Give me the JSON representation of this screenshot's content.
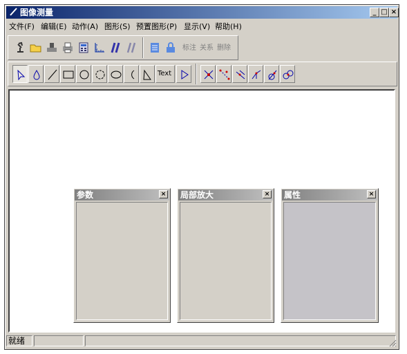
{
  "window": {
    "title": "图像测量",
    "minimize": "_",
    "maximize": "□",
    "close": "×"
  },
  "menu": [
    {
      "label": "文件(F)"
    },
    {
      "label": "编辑(E)"
    },
    {
      "label": "动作(A)"
    },
    {
      "label": "图形(S)"
    },
    {
      "label": "预置图形(P)"
    },
    {
      "label": "显示(V)"
    },
    {
      "label": "帮助(H)"
    }
  ],
  "toolbar1": {
    "icons": [
      "microscope-icon",
      "folder-open-icon",
      "scanner-icon",
      "print-icon",
      "calculator-icon",
      "ruler-icon",
      "parallel-lines-icon",
      "parallel-lines-outline-icon",
      "document-list-icon",
      "lock-icon"
    ],
    "labels": {
      "annotate": "标注",
      "relation": "关系",
      "delete": "删除"
    }
  },
  "toolbar2": {
    "tools": [
      "select",
      "drop",
      "line",
      "rectangle",
      "circle",
      "dotted-circle",
      "ellipse",
      "arc",
      "polygon",
      "text",
      "triangle"
    ],
    "text_tool_label": "Text",
    "measure_tools": [
      "measure-1",
      "measure-2",
      "measure-3",
      "measure-4",
      "measure-5",
      "measure-6"
    ]
  },
  "panels": {
    "params": {
      "title": "参数",
      "close": "×"
    },
    "zoom": {
      "title": "局部放大",
      "close": "×"
    },
    "props": {
      "title": "属性",
      "close": "×"
    }
  },
  "status": {
    "text": "就绪"
  },
  "colors": {
    "title_start": "#0a246a",
    "title_end": "#a6caf0",
    "face": "#d4d0c8",
    "props_body": "#c5c3c8"
  }
}
